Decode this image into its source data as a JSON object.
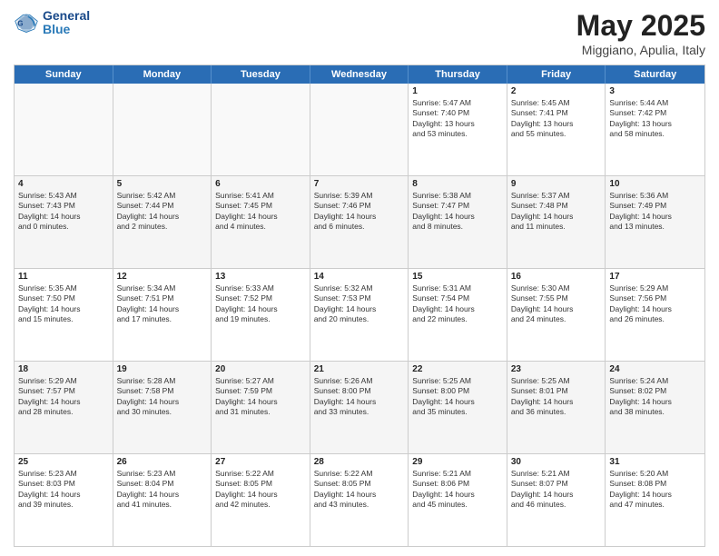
{
  "header": {
    "logo_line1": "General",
    "logo_line2": "Blue",
    "month": "May 2025",
    "location": "Miggiano, Apulia, Italy"
  },
  "days": [
    "Sunday",
    "Monday",
    "Tuesday",
    "Wednesday",
    "Thursday",
    "Friday",
    "Saturday"
  ],
  "weeks": [
    [
      {
        "day": "",
        "info": ""
      },
      {
        "day": "",
        "info": ""
      },
      {
        "day": "",
        "info": ""
      },
      {
        "day": "",
        "info": ""
      },
      {
        "day": "1",
        "info": "Sunrise: 5:47 AM\nSunset: 7:40 PM\nDaylight: 13 hours\nand 53 minutes."
      },
      {
        "day": "2",
        "info": "Sunrise: 5:45 AM\nSunset: 7:41 PM\nDaylight: 13 hours\nand 55 minutes."
      },
      {
        "day": "3",
        "info": "Sunrise: 5:44 AM\nSunset: 7:42 PM\nDaylight: 13 hours\nand 58 minutes."
      }
    ],
    [
      {
        "day": "4",
        "info": "Sunrise: 5:43 AM\nSunset: 7:43 PM\nDaylight: 14 hours\nand 0 minutes."
      },
      {
        "day": "5",
        "info": "Sunrise: 5:42 AM\nSunset: 7:44 PM\nDaylight: 14 hours\nand 2 minutes."
      },
      {
        "day": "6",
        "info": "Sunrise: 5:41 AM\nSunset: 7:45 PM\nDaylight: 14 hours\nand 4 minutes."
      },
      {
        "day": "7",
        "info": "Sunrise: 5:39 AM\nSunset: 7:46 PM\nDaylight: 14 hours\nand 6 minutes."
      },
      {
        "day": "8",
        "info": "Sunrise: 5:38 AM\nSunset: 7:47 PM\nDaylight: 14 hours\nand 8 minutes."
      },
      {
        "day": "9",
        "info": "Sunrise: 5:37 AM\nSunset: 7:48 PM\nDaylight: 14 hours\nand 11 minutes."
      },
      {
        "day": "10",
        "info": "Sunrise: 5:36 AM\nSunset: 7:49 PM\nDaylight: 14 hours\nand 13 minutes."
      }
    ],
    [
      {
        "day": "11",
        "info": "Sunrise: 5:35 AM\nSunset: 7:50 PM\nDaylight: 14 hours\nand 15 minutes."
      },
      {
        "day": "12",
        "info": "Sunrise: 5:34 AM\nSunset: 7:51 PM\nDaylight: 14 hours\nand 17 minutes."
      },
      {
        "day": "13",
        "info": "Sunrise: 5:33 AM\nSunset: 7:52 PM\nDaylight: 14 hours\nand 19 minutes."
      },
      {
        "day": "14",
        "info": "Sunrise: 5:32 AM\nSunset: 7:53 PM\nDaylight: 14 hours\nand 20 minutes."
      },
      {
        "day": "15",
        "info": "Sunrise: 5:31 AM\nSunset: 7:54 PM\nDaylight: 14 hours\nand 22 minutes."
      },
      {
        "day": "16",
        "info": "Sunrise: 5:30 AM\nSunset: 7:55 PM\nDaylight: 14 hours\nand 24 minutes."
      },
      {
        "day": "17",
        "info": "Sunrise: 5:29 AM\nSunset: 7:56 PM\nDaylight: 14 hours\nand 26 minutes."
      }
    ],
    [
      {
        "day": "18",
        "info": "Sunrise: 5:29 AM\nSunset: 7:57 PM\nDaylight: 14 hours\nand 28 minutes."
      },
      {
        "day": "19",
        "info": "Sunrise: 5:28 AM\nSunset: 7:58 PM\nDaylight: 14 hours\nand 30 minutes."
      },
      {
        "day": "20",
        "info": "Sunrise: 5:27 AM\nSunset: 7:59 PM\nDaylight: 14 hours\nand 31 minutes."
      },
      {
        "day": "21",
        "info": "Sunrise: 5:26 AM\nSunset: 8:00 PM\nDaylight: 14 hours\nand 33 minutes."
      },
      {
        "day": "22",
        "info": "Sunrise: 5:25 AM\nSunset: 8:00 PM\nDaylight: 14 hours\nand 35 minutes."
      },
      {
        "day": "23",
        "info": "Sunrise: 5:25 AM\nSunset: 8:01 PM\nDaylight: 14 hours\nand 36 minutes."
      },
      {
        "day": "24",
        "info": "Sunrise: 5:24 AM\nSunset: 8:02 PM\nDaylight: 14 hours\nand 38 minutes."
      }
    ],
    [
      {
        "day": "25",
        "info": "Sunrise: 5:23 AM\nSunset: 8:03 PM\nDaylight: 14 hours\nand 39 minutes."
      },
      {
        "day": "26",
        "info": "Sunrise: 5:23 AM\nSunset: 8:04 PM\nDaylight: 14 hours\nand 41 minutes."
      },
      {
        "day": "27",
        "info": "Sunrise: 5:22 AM\nSunset: 8:05 PM\nDaylight: 14 hours\nand 42 minutes."
      },
      {
        "day": "28",
        "info": "Sunrise: 5:22 AM\nSunset: 8:05 PM\nDaylight: 14 hours\nand 43 minutes."
      },
      {
        "day": "29",
        "info": "Sunrise: 5:21 AM\nSunset: 8:06 PM\nDaylight: 14 hours\nand 45 minutes."
      },
      {
        "day": "30",
        "info": "Sunrise: 5:21 AM\nSunset: 8:07 PM\nDaylight: 14 hours\nand 46 minutes."
      },
      {
        "day": "31",
        "info": "Sunrise: 5:20 AM\nSunset: 8:08 PM\nDaylight: 14 hours\nand 47 minutes."
      }
    ]
  ]
}
